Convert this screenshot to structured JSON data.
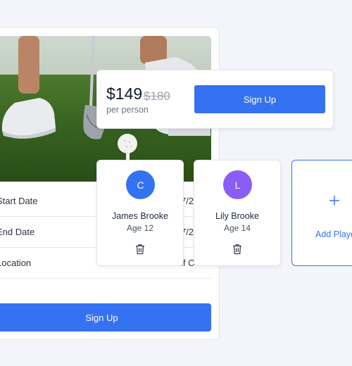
{
  "program": {
    "details": [
      {
        "label": "Start Date",
        "value": "7/2"
      },
      {
        "label": "End Date",
        "value": "7/2"
      },
      {
        "label": "Location",
        "value": "lf C"
      }
    ],
    "signup_label": "Sign Up"
  },
  "pricing": {
    "price": "$149",
    "original_price": "$180",
    "unit": "per person",
    "signup_label": "Sign Up"
  },
  "players": [
    {
      "initial": "C",
      "name": "James Brooke",
      "age": "Age 12",
      "avatar_color": "#3572f2"
    },
    {
      "initial": "L",
      "name": "Lily Brooke",
      "age": "Age 14",
      "avatar_color": "#8b5cf6"
    }
  ],
  "add_player": {
    "label": "Add Player"
  },
  "colors": {
    "accent": "#3572f2",
    "background": "#f4f5fa"
  }
}
